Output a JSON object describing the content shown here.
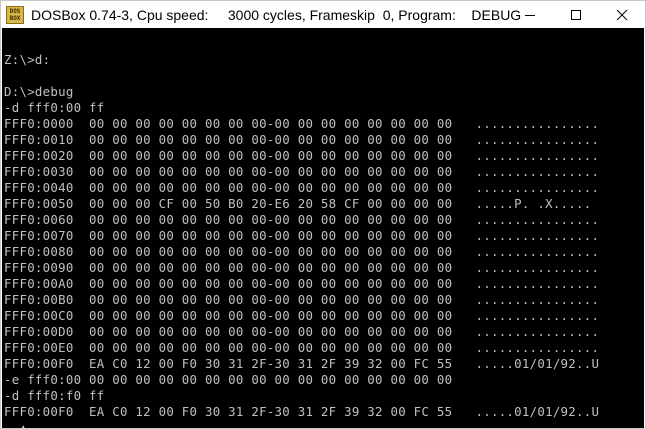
{
  "window": {
    "title": "DOSBox 0.74-3, Cpu speed:     3000 cycles, Frameskip  0, Program:    DEBUG",
    "icon_label": "DOS BOX"
  },
  "terminal": {
    "lines": [
      "",
      "Z:\\>d:",
      "",
      "D:\\>debug",
      "-d fff0:00 ff",
      "FFF0:0000  00 00 00 00 00 00 00 00-00 00 00 00 00 00 00 00   ................",
      "FFF0:0010  00 00 00 00 00 00 00 00-00 00 00 00 00 00 00 00   ................",
      "FFF0:0020  00 00 00 00 00 00 00 00-00 00 00 00 00 00 00 00   ................",
      "FFF0:0030  00 00 00 00 00 00 00 00-00 00 00 00 00 00 00 00   ................",
      "FFF0:0040  00 00 00 00 00 00 00 00-00 00 00 00 00 00 00 00   ................",
      "FFF0:0050  00 00 00 CF 00 50 B0 20-E6 20 58 CF 00 00 00 00   .....P. .X.....",
      "FFF0:0060  00 00 00 00 00 00 00 00-00 00 00 00 00 00 00 00   ................",
      "FFF0:0070  00 00 00 00 00 00 00 00-00 00 00 00 00 00 00 00   ................",
      "FFF0:0080  00 00 00 00 00 00 00 00-00 00 00 00 00 00 00 00   ................",
      "FFF0:0090  00 00 00 00 00 00 00 00-00 00 00 00 00 00 00 00   ................",
      "FFF0:00A0  00 00 00 00 00 00 00 00-00 00 00 00 00 00 00 00   ................",
      "FFF0:00B0  00 00 00 00 00 00 00 00-00 00 00 00 00 00 00 00   ................",
      "FFF0:00C0  00 00 00 00 00 00 00 00-00 00 00 00 00 00 00 00   ................",
      "FFF0:00D0  00 00 00 00 00 00 00 00-00 00 00 00 00 00 00 00   ................",
      "FFF0:00E0  00 00 00 00 00 00 00 00-00 00 00 00 00 00 00 00   ................",
      "FFF0:00F0  EA C0 12 00 F0 30 31 2F-30 31 2F 39 32 00 FC 55   .....01/01/92..U",
      "-e fff0:00 00 00 00 00 00 00 00 00 00 00 00 00 00 00 00 00",
      "-d fff0:f0 ff",
      "FFF0:00F0  EA C0 12 00 F0 30 31 2F-30 31 2F 39 32 00 FC 55   .....01/01/92..U",
      "- ▲"
    ]
  }
}
